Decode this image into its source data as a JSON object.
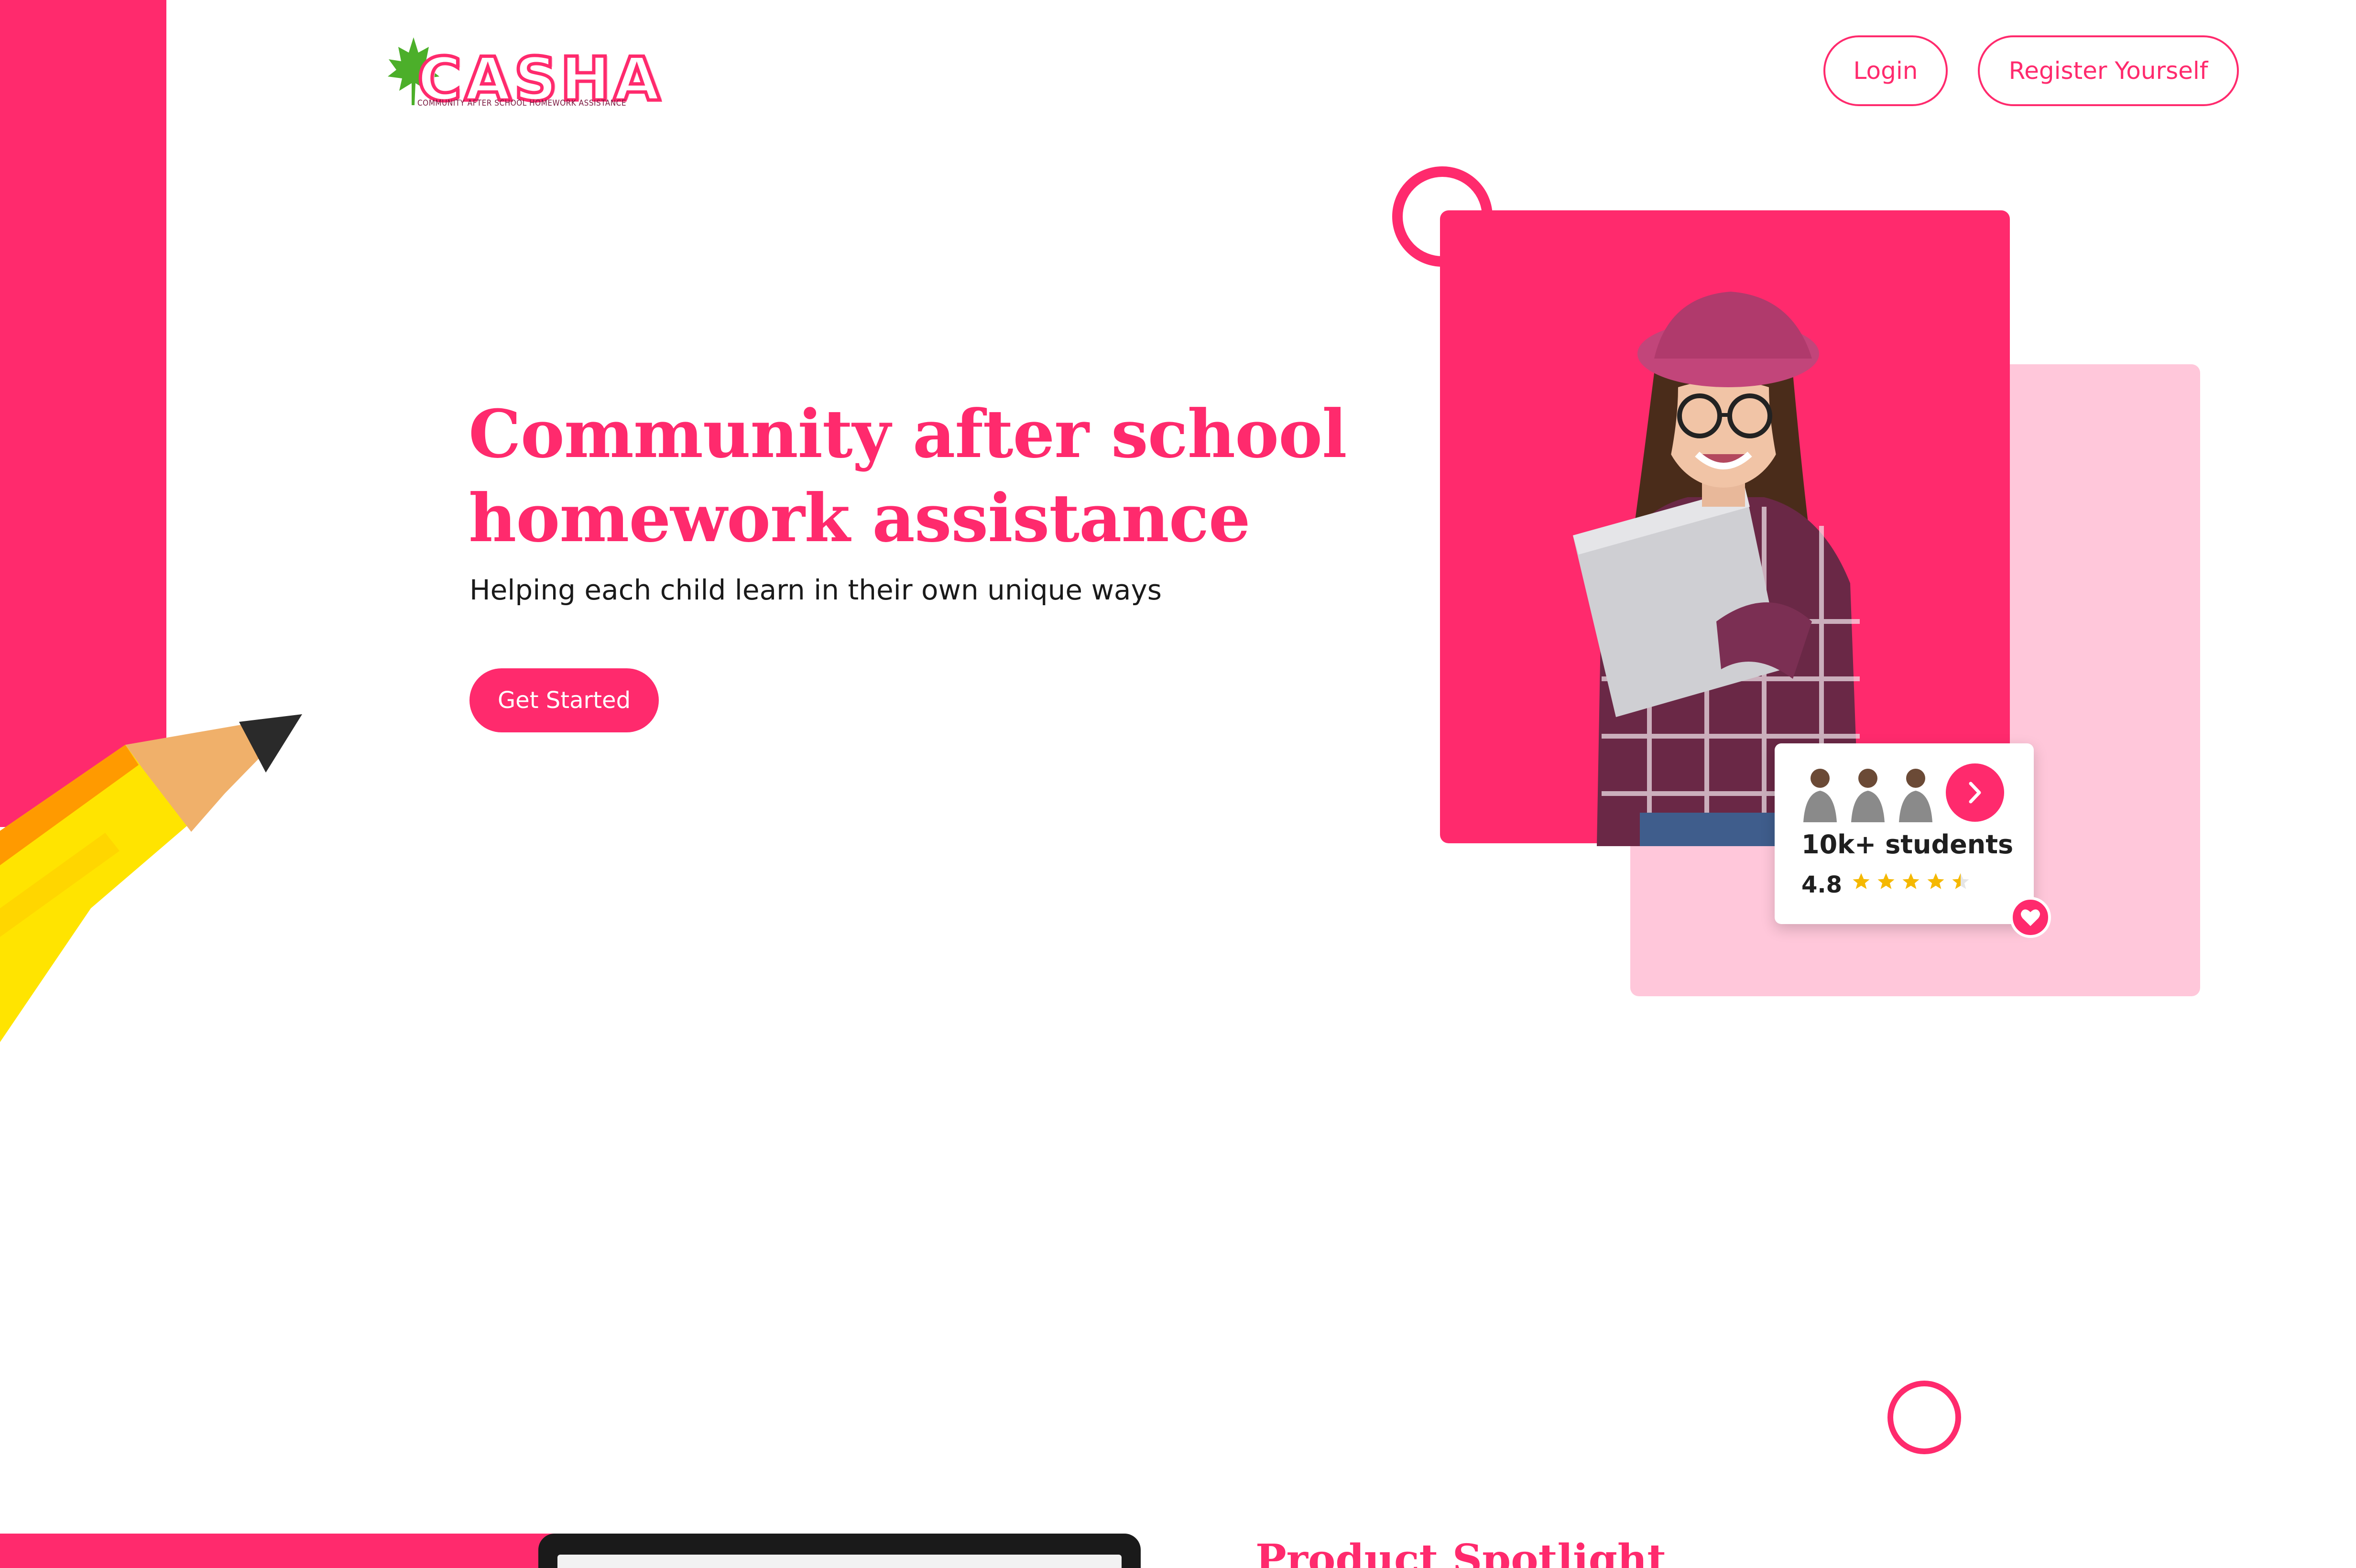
{
  "header": {
    "logo_text": "CASHA",
    "logo_subtitle": "COMMUNITY AFTER SCHOOL HOMEWORK ASSISTANCE",
    "login_label": "Login",
    "register_label": "Register Yourself"
  },
  "hero": {
    "title_line1": "Community after school",
    "title_line2": "homework assistance",
    "subtitle": "Helping each child learn in their own unique ways",
    "cta_label": "Get Started"
  },
  "stats": {
    "students_label": "10k+ students",
    "rating_value": "4.8",
    "rating_stars": 4.5
  },
  "next_section": {
    "title": "Product Spotlight"
  },
  "colors": {
    "accent": "#ff2a6d",
    "accent_light": "#ffc7da",
    "star": "#f5b800",
    "leaf": "#4caf2a"
  },
  "icons": [
    "maple-leaf-icon",
    "chevron-right-icon",
    "star-icon",
    "heart-icon",
    "pencil-illustration"
  ]
}
